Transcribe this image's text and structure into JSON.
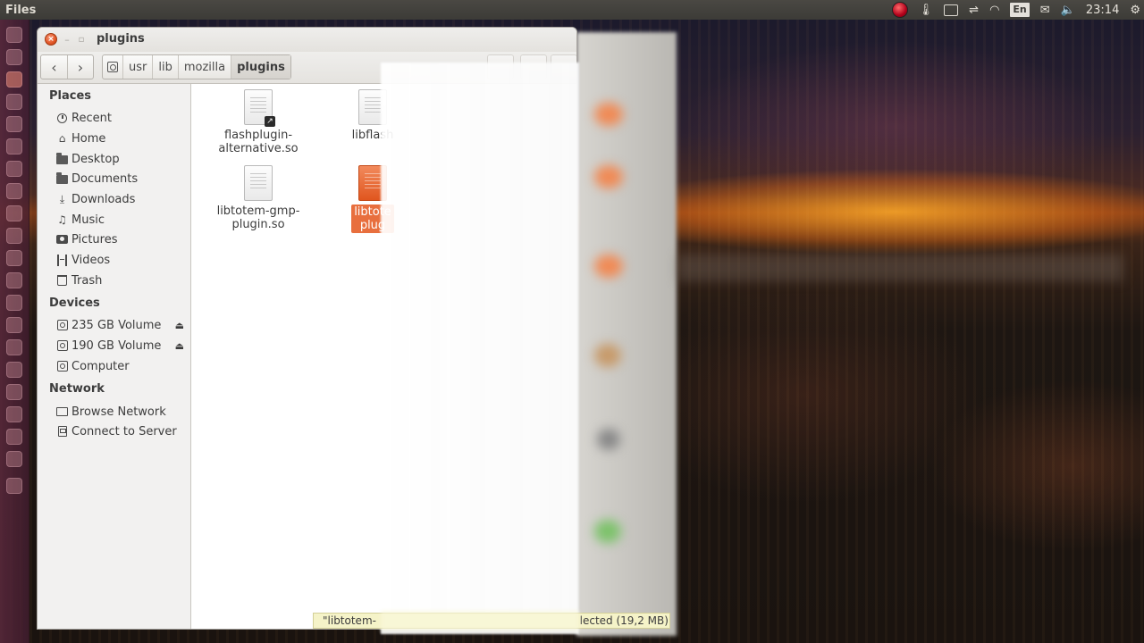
{
  "top_panel": {
    "app_title": "Files",
    "keyboard_layout": "En",
    "time": "23:14"
  },
  "window": {
    "title": "plugins",
    "close_glyph": "×",
    "minimize_glyph": "–",
    "maximize_glyph": "▫"
  },
  "toolbar": {
    "back_glyph": "‹",
    "forward_glyph": "›",
    "path": [
      "usr",
      "lib",
      "mozilla",
      "plugins"
    ]
  },
  "sidebar": {
    "places_heading": "Places",
    "places": [
      {
        "label": "Recent",
        "icon": "clock-icon"
      },
      {
        "label": "Home",
        "icon": "home-icon"
      },
      {
        "label": "Desktop",
        "icon": "desktop-folder-icon"
      },
      {
        "label": "Documents",
        "icon": "documents-icon"
      },
      {
        "label": "Downloads",
        "icon": "download-icon"
      },
      {
        "label": "Music",
        "icon": "music-icon"
      },
      {
        "label": "Pictures",
        "icon": "camera-icon"
      },
      {
        "label": "Videos",
        "icon": "film-icon"
      },
      {
        "label": "Trash",
        "icon": "trash-icon"
      }
    ],
    "devices_heading": "Devices",
    "devices": [
      {
        "label": "235 GB Volume",
        "icon": "drive-icon",
        "ejectable": true
      },
      {
        "label": "190 GB Volume",
        "icon": "drive-icon",
        "ejectable": true
      },
      {
        "label": "Computer",
        "icon": "drive-icon",
        "ejectable": false
      }
    ],
    "network_heading": "Network",
    "network": [
      {
        "label": "Browse Network",
        "icon": "network-icon"
      },
      {
        "label": "Connect to Server",
        "icon": "server-icon"
      }
    ],
    "eject_glyph": "⏏"
  },
  "files": [
    {
      "name_line1": "flashplugin-",
      "name_line2": "alternative.so",
      "symlink": true,
      "selected": false
    },
    {
      "name_line1": "libflash",
      "name_line2": "",
      "symlink": false,
      "selected": false
    },
    {
      "name_line1": "libtotem-gmp-",
      "name_line2": "plugin.so",
      "symlink": false,
      "selected": false
    },
    {
      "name_line1": "libtote",
      "name_line2": "plug",
      "symlink": false,
      "selected": true
    }
  ],
  "status_bar": {
    "text": "\"libtotem-",
    "text_tail": "lected (19,2 MB)"
  },
  "colors": {
    "selection": "#e86f3e",
    "panel": "#3c3b37",
    "status_bg": "#f5f3c8"
  }
}
